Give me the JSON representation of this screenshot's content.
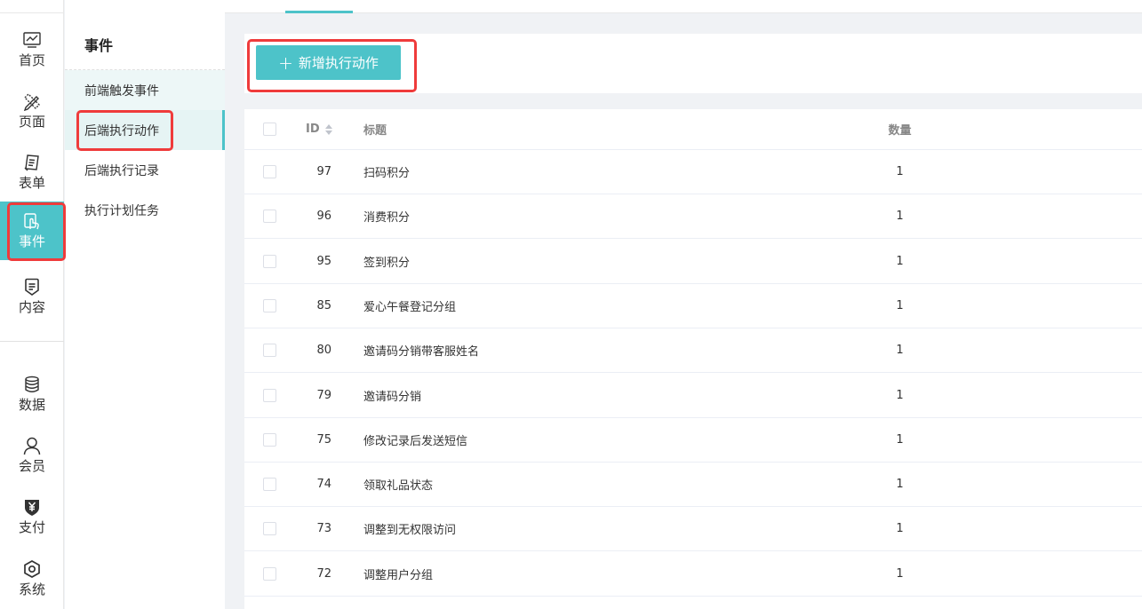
{
  "rail": {
    "items": [
      {
        "label": "首页",
        "icon": "home-chart-icon"
      },
      {
        "label": "页面",
        "icon": "pencil-ruler-icon"
      },
      {
        "label": "表单",
        "icon": "form-doc-icon"
      },
      {
        "label": "事件",
        "icon": "touch-event-icon",
        "active": true
      },
      {
        "label": "内容",
        "icon": "content-shield-icon"
      },
      {
        "label": "数据",
        "icon": "database-icon"
      },
      {
        "label": "会员",
        "icon": "user-icon"
      },
      {
        "label": "支付",
        "icon": "yen-shield-icon"
      },
      {
        "label": "系统",
        "icon": "settings-hex-icon"
      }
    ]
  },
  "subnav": {
    "title": "事件",
    "items": [
      {
        "label": "前端触发事件"
      },
      {
        "label": "后端执行动作",
        "active": true
      },
      {
        "label": "后端执行记录"
      },
      {
        "label": "执行计划任务"
      }
    ]
  },
  "toolbar": {
    "add_label": "新增执行动作"
  },
  "table": {
    "headers": {
      "id": "ID",
      "title": "标题",
      "quantity": "数量"
    },
    "rows": [
      {
        "id": "97",
        "title": "扫码积分",
        "quantity": "1"
      },
      {
        "id": "96",
        "title": "消费积分",
        "quantity": "1"
      },
      {
        "id": "95",
        "title": "签到积分",
        "quantity": "1"
      },
      {
        "id": "85",
        "title": "爱心午餐登记分组",
        "quantity": "1"
      },
      {
        "id": "80",
        "title": "邀请码分销带客服姓名",
        "quantity": "1"
      },
      {
        "id": "79",
        "title": "邀请码分销",
        "quantity": "1"
      },
      {
        "id": "75",
        "title": "修改记录后发送短信",
        "quantity": "1"
      },
      {
        "id": "74",
        "title": "领取礼品状态",
        "quantity": "1"
      },
      {
        "id": "73",
        "title": "调整到无权限访问",
        "quantity": "1"
      },
      {
        "id": "72",
        "title": "调整用户分组",
        "quantity": "1"
      }
    ]
  },
  "colors": {
    "accent": "#4dc3c9",
    "highlight": "#ef3b3b"
  }
}
